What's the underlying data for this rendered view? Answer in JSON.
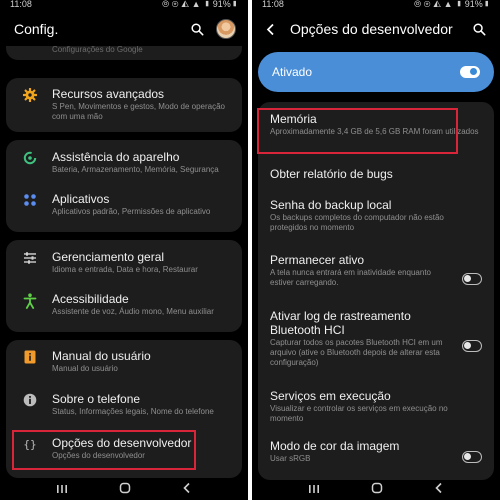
{
  "left": {
    "status": {
      "time": "11:08",
      "indicators": "⦾ ⊛ ◭ ▲ ▮ 91%▮"
    },
    "header": {
      "title": "Config."
    },
    "scrolled_hint": "Configurações do Google",
    "items": [
      {
        "title": "Recursos avançados",
        "subtitle": "S Pen, Movimentos e gestos, Modo de operação com uma mão",
        "icon": "gear-plus-icon",
        "color": "#f0a51c"
      },
      {
        "title": "Assistência do aparelho",
        "subtitle": "Bateria, Armazenamento, Memória, Segurança",
        "icon": "refresh-circle-icon",
        "color": "#3fc17f"
      },
      {
        "title": "Aplicativos",
        "subtitle": "Aplicativos padrão, Permissões de aplicativo",
        "icon": "apps-grid-icon",
        "color": "#5b8cf0"
      },
      {
        "title": "Gerenciamento geral",
        "subtitle": "Idioma e entrada, Data e hora, Restaurar",
        "icon": "sliders-icon",
        "color": "#d0d0d0"
      },
      {
        "title": "Acessibilidade",
        "subtitle": "Assistente de voz, Áudio mono, Menu auxiliar",
        "icon": "accessibility-icon",
        "color": "#5fcf47"
      },
      {
        "title": "Manual do usuário",
        "subtitle": "Manual do usuário",
        "icon": "manual-book-icon",
        "color": "#f09b2c"
      },
      {
        "title": "Sobre o telefone",
        "subtitle": "Status, Informações legais, Nome do telefone",
        "icon": "info-icon",
        "color": "#bcbcbc"
      },
      {
        "title": "Opções do desenvolvedor",
        "subtitle": "Opções do desenvolvedor",
        "icon": "braces-icon",
        "color": "#bcbcbc"
      }
    ]
  },
  "right": {
    "status": {
      "time": "11:08",
      "indicators": "⦾ ⊛ ◭ ▲ ▮ 91%▮"
    },
    "header": {
      "title": "Opções do desenvolvedor"
    },
    "master_toggle": {
      "label": "Ativado",
      "on": true
    },
    "items": [
      {
        "title": "Memória",
        "subtitle": "Aproximadamente 3,4 GB de 5,6 GB RAM foram utilizados"
      },
      {
        "title": "Obter relatório de bugs",
        "subtitle": ""
      },
      {
        "title": "Senha do backup local",
        "subtitle": "Os backups completos do computador não estão protegidos no momento"
      },
      {
        "title": "Permanecer ativo",
        "subtitle": "A tela nunca entrará em inatividade enquanto estiver carregando.",
        "toggle": false
      },
      {
        "title": "Ativar log de rastreamento Bluetooth HCI",
        "subtitle": "Capturar todos os pacotes Bluetooth HCI em um arquivo (ative o Bluetooth depois de alterar esta configuração)",
        "toggle": false
      },
      {
        "title": "Serviços em execução",
        "subtitle": "Visualizar e controlar os serviços em execução no momento"
      },
      {
        "title": "Modo de cor da imagem",
        "subtitle": "Usar sRGB",
        "toggle": false
      }
    ]
  }
}
